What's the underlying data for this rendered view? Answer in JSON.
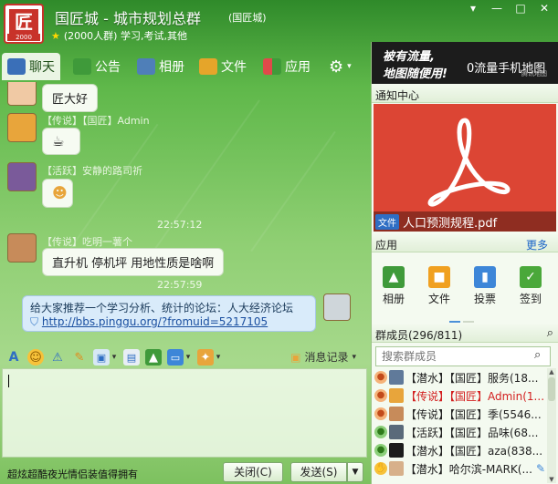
{
  "window": {
    "title": "国匠城 - 城市规划总群",
    "tag": "(国匠城)",
    "subtitle": "(2000人群) 学习,考试,其他",
    "logo_text": "匠",
    "logo_year": "2000"
  },
  "tabs": [
    {
      "label": "聊天",
      "color": "#3a6fb8"
    },
    {
      "label": "公告",
      "color": "#3f9a3a"
    },
    {
      "label": "相册",
      "color": "#4f7fb8"
    },
    {
      "label": "文件",
      "color": "#e5a52a"
    },
    {
      "label": "应用",
      "color": "#e04a4a"
    }
  ],
  "chat": {
    "m1_text": "匠大好",
    "m2_sender": "【传说】【国匠】Admin",
    "m3_sender": "【活跃】安静的路司祈",
    "time1": "22:57:12",
    "m4_sender": "【传说】吃明一薯个",
    "m4_text": "直升机  停机坪  用地性质是啥啊",
    "time2": "22:57:59",
    "out_text": "给大家推荐一个学习分析、统计的论坛：人大经济论坛",
    "out_link": "http://bbs.pinggu.org/?fromuid=5217105"
  },
  "toolbar": {
    "history_label": "消息记录"
  },
  "bottom": {
    "promo": "超炫超酷夜光情侣装值得拥有",
    "close_label": "关闭(C)",
    "send_label": "发送(S)"
  },
  "right": {
    "ad_line1": "被有流量,",
    "ad_line2": "地图随便用!",
    "ad_right": "0流量手机地图",
    "ad_sub": "腾讯地图",
    "notice_header": "通知中心",
    "file_tag": "文件",
    "file_name": "人口预测规程.pdf",
    "apps_header": "应用",
    "more_label": "更多",
    "apps": [
      {
        "label": "相册",
        "color": "#3f9a3a",
        "glyph": "▲"
      },
      {
        "label": "文件",
        "color": "#f0a020",
        "glyph": "■"
      },
      {
        "label": "投票",
        "color": "#3d86d8",
        "glyph": "▮"
      },
      {
        "label": "签到",
        "color": "#4aa83a",
        "glyph": "✓"
      }
    ],
    "members_header": "群成员(296/811)",
    "search_placeholder": "搜索群成员",
    "members": [
      {
        "name": "【潜水】【国匠】服务(18...",
        "color": "#222"
      },
      {
        "name": "【传说】【国匠】Admin(1...",
        "color": "#d32020"
      },
      {
        "name": "【传说】【国匠】季(5546...",
        "color": "#222"
      },
      {
        "name": "【活跃】【国匠】品味(68...",
        "color": "#222"
      },
      {
        "name": "【潜水】【国匠】aza(838...",
        "color": "#222"
      },
      {
        "name": "【潜水】哈尔滨-MARK(...",
        "color": "#222"
      }
    ]
  }
}
